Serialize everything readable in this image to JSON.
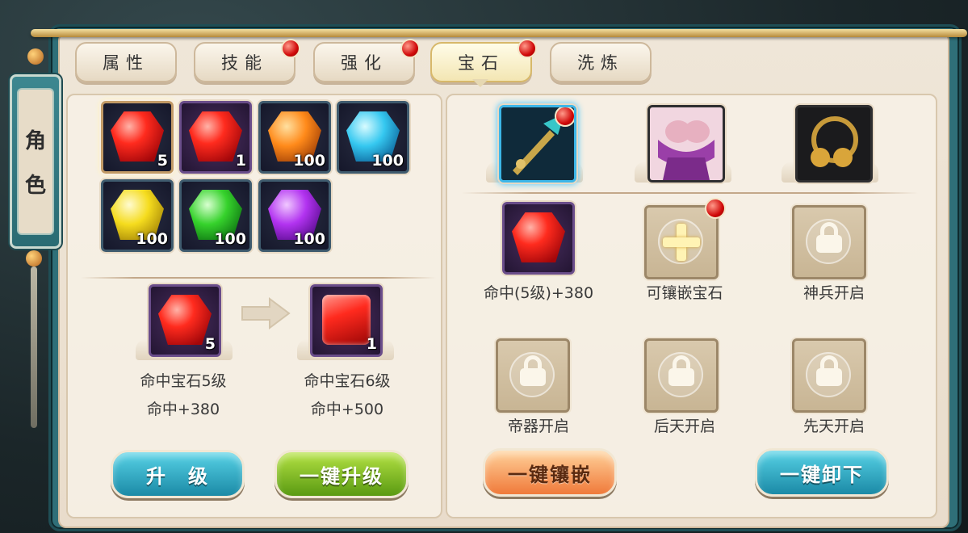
{
  "side_tab": {
    "chars": [
      "角",
      "色"
    ]
  },
  "tabs": [
    {
      "label": "属性",
      "badge": false
    },
    {
      "label": "技能",
      "badge": true
    },
    {
      "label": "强化",
      "badge": true
    },
    {
      "label": "宝石",
      "badge": true,
      "active": true
    },
    {
      "label": "洗炼",
      "badge": false
    }
  ],
  "inventory": [
    {
      "color": "red",
      "qty": "5",
      "selected": true
    },
    {
      "color": "red",
      "qty": "1"
    },
    {
      "color": "orange",
      "qty": "100"
    },
    {
      "color": "cyan",
      "qty": "100"
    },
    {
      "color": "yellow",
      "qty": "100"
    },
    {
      "color": "green",
      "qty": "100"
    },
    {
      "color": "violet",
      "qty": "100"
    }
  ],
  "upgrade": {
    "from": {
      "qty": "5",
      "name": "命中宝石5级",
      "stat": "命中+380"
    },
    "to": {
      "qty": "1",
      "name": "命中宝石6级",
      "stat": "命中+500"
    }
  },
  "buttons": {
    "upgrade": "升　级",
    "upgrade_all": "一键升级",
    "inlay_all": "一键镶嵌",
    "remove_all": "一键卸下"
  },
  "equipment": [
    {
      "name": "weapon",
      "badge": true,
      "selected": true
    },
    {
      "name": "armor",
      "badge": false
    },
    {
      "name": "bell-accessory",
      "badge": false
    }
  ],
  "sockets": [
    {
      "type": "gem",
      "label": "命中(5级)+380"
    },
    {
      "type": "add",
      "label": "可镶嵌宝石",
      "badge": true
    },
    {
      "type": "locked",
      "label": "神兵开启"
    },
    {
      "type": "locked",
      "label": "帝器开启"
    },
    {
      "type": "locked",
      "label": "后天开启"
    },
    {
      "type": "locked",
      "label": "先天开启"
    }
  ],
  "colors": {
    "accent": "#2f6f78",
    "badge": "#d10a0a",
    "panel": "#efe6d8"
  }
}
